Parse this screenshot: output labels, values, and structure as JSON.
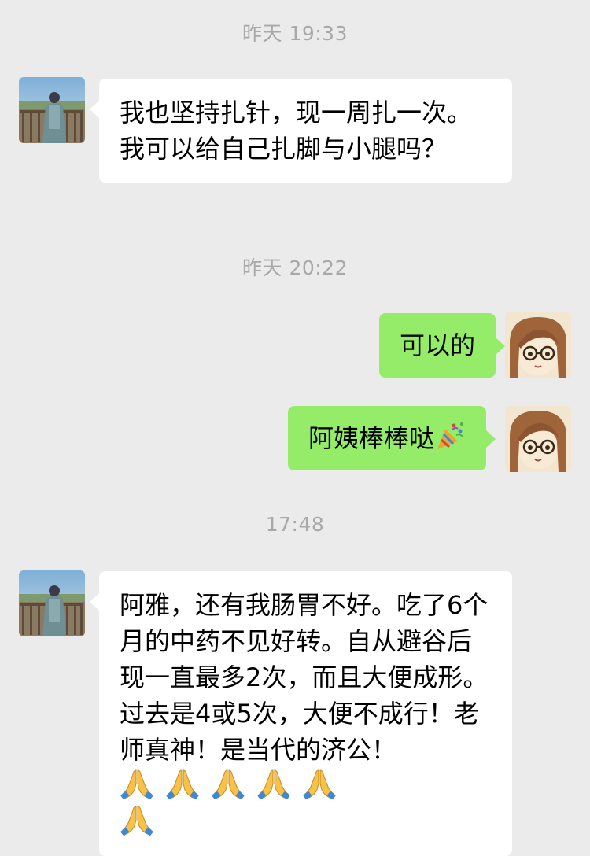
{
  "messages": [
    {
      "timestamp": "昨天 19:33",
      "direction": "incoming",
      "text": "我也坚持扎针，现一周扎一次。我可以给自己扎脚与小腿吗？"
    },
    {
      "timestamp": "昨天 20:22",
      "direction": "outgoing",
      "text": "可以的"
    },
    {
      "direction": "outgoing",
      "text": "阿姨棒棒哒",
      "trailing_emoji": "party-popper-icon"
    },
    {
      "timestamp": "17:48",
      "direction": "incoming",
      "text": "阿雅，还有我肠胃不好。吃了6个月的中药不见好转。自从避谷后现一直最多2次，而且大便成形。过去是4或5次，大便不成行！老师真神！是当代的济公！",
      "trailing_emoji": "folded-hands-icon",
      "trailing_emoji_count": 6
    }
  ],
  "colors": {
    "background": "#ebebeb",
    "incoming_bubble": "#ffffff",
    "outgoing_bubble": "#95ec69",
    "timestamp_text": "#a8a8a8"
  }
}
